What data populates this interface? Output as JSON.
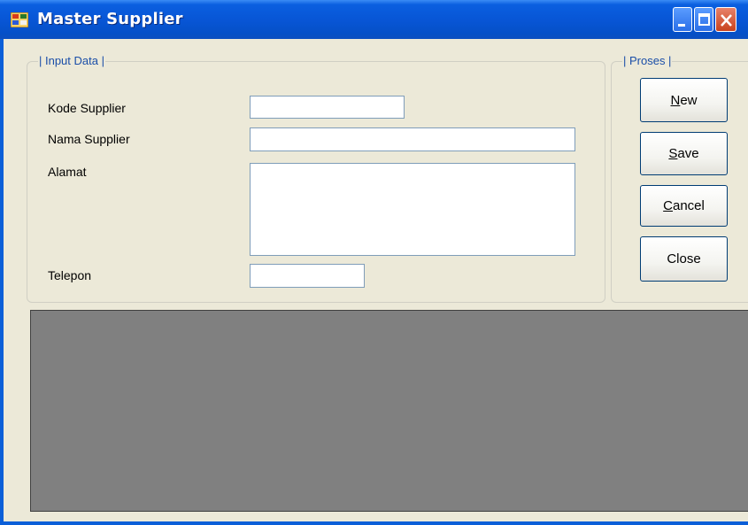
{
  "window": {
    "title": "Master Supplier"
  },
  "input_group": {
    "legend": "| Input Data |",
    "fields": {
      "kode_label": "Kode Supplier",
      "kode_value": "",
      "nama_label": "Nama Supplier",
      "nama_value": "",
      "alamat_label": "Alamat",
      "alamat_value": "",
      "telepon_label": "Telepon",
      "telepon_value": ""
    }
  },
  "proses_group": {
    "legend": "| Proses |",
    "buttons": {
      "new_mnemonic": "N",
      "new_rest": "ew",
      "save_mnemonic": "S",
      "save_rest": "ave",
      "cancel_mnemonic": "C",
      "cancel_rest": "ancel",
      "close_label": "Close"
    }
  },
  "icons": {
    "app": "form-app-icon",
    "minimize": "minimize-icon",
    "maximize": "maximize-icon",
    "close": "close-icon"
  }
}
